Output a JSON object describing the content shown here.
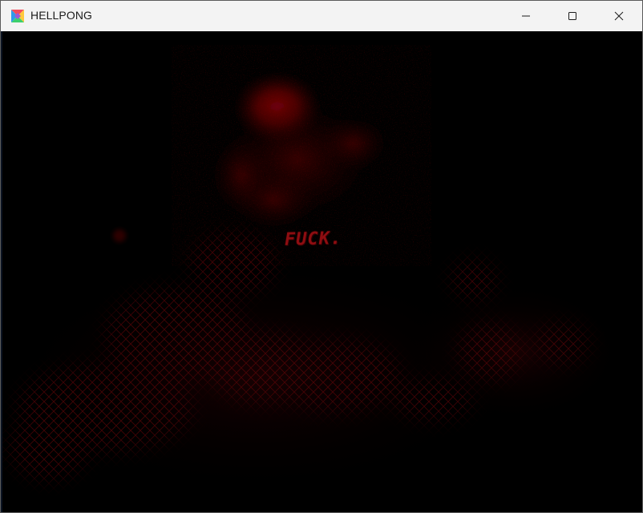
{
  "window": {
    "title": "HELLPONG",
    "app_icon": "colorful-app-icon",
    "controls": {
      "minimize_icon": "minimize-icon",
      "maximize_icon": "maximize-icon",
      "close_icon": "close-icon"
    }
  },
  "game": {
    "message": "FUCK.",
    "colors": {
      "background": "#000000",
      "blood": "#8e0d11",
      "grid": "#5a0508"
    }
  }
}
